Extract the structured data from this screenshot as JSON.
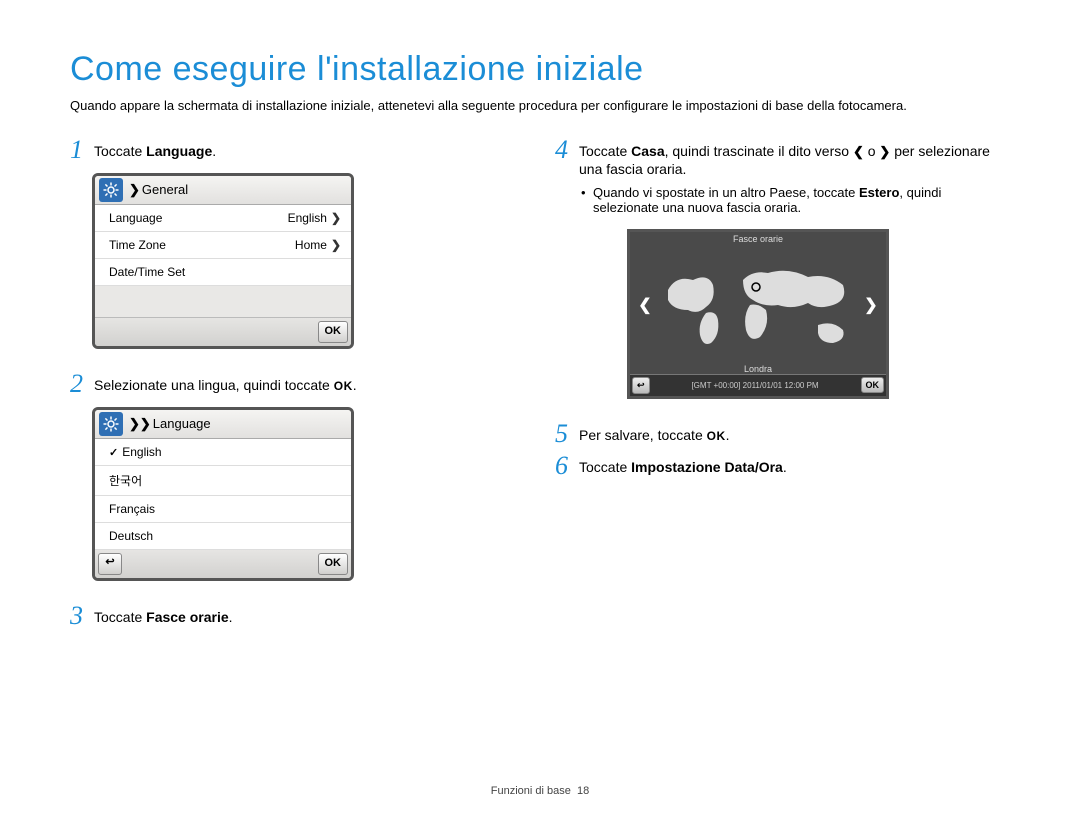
{
  "title": "Come eseguire l'installazione iniziale",
  "intro": "Quando appare la schermata di installazione iniziale, attenetevi alla seguente procedura per configurare le impostazioni di base della fotocamera.",
  "ok_label": "OK",
  "steps": {
    "s1": {
      "num": "1",
      "pre": "Toccate ",
      "bold": "Language",
      "post": "."
    },
    "s2": {
      "num": "2",
      "text": "Selezionate una lingua, quindi toccate "
    },
    "s3": {
      "num": "3",
      "pre": "Toccate ",
      "bold": "Fasce orarie",
      "post": "."
    },
    "s4": {
      "num": "4",
      "pre": "Toccate ",
      "bold": "Casa",
      "mid1": ", quindi trascinate il dito verso ",
      "mid2": " o ",
      "post": " per selezionare una fascia oraria."
    },
    "s4_bullet_pre": "Quando vi spostate in un altro Paese, toccate ",
    "s4_bullet_bold": "Estero",
    "s4_bullet_post": ", quindi selezionate una nuova fascia oraria.",
    "s5": {
      "num": "5",
      "text": "Per salvare, toccate "
    },
    "s6": {
      "num": "6",
      "pre": "Toccate ",
      "bold": "Impostazione Data/Ora",
      "post": "."
    }
  },
  "shot1": {
    "header": "General",
    "rows": [
      {
        "label": "Language",
        "value": "English"
      },
      {
        "label": "Time Zone",
        "value": "Home"
      },
      {
        "label": "Date/Time Set",
        "value": ""
      }
    ],
    "ok": "OK"
  },
  "shot2": {
    "header": "Language",
    "items": [
      "English",
      "한국어",
      "Français",
      "Deutsch"
    ],
    "ok": "OK"
  },
  "shot3": {
    "title": "Fasce orarie",
    "city": "Londra",
    "gmt": "[GMT +00:00]  2011/01/01 12:00 PM",
    "ok": "OK"
  },
  "footer": {
    "label": "Funzioni di base",
    "page": "18"
  }
}
